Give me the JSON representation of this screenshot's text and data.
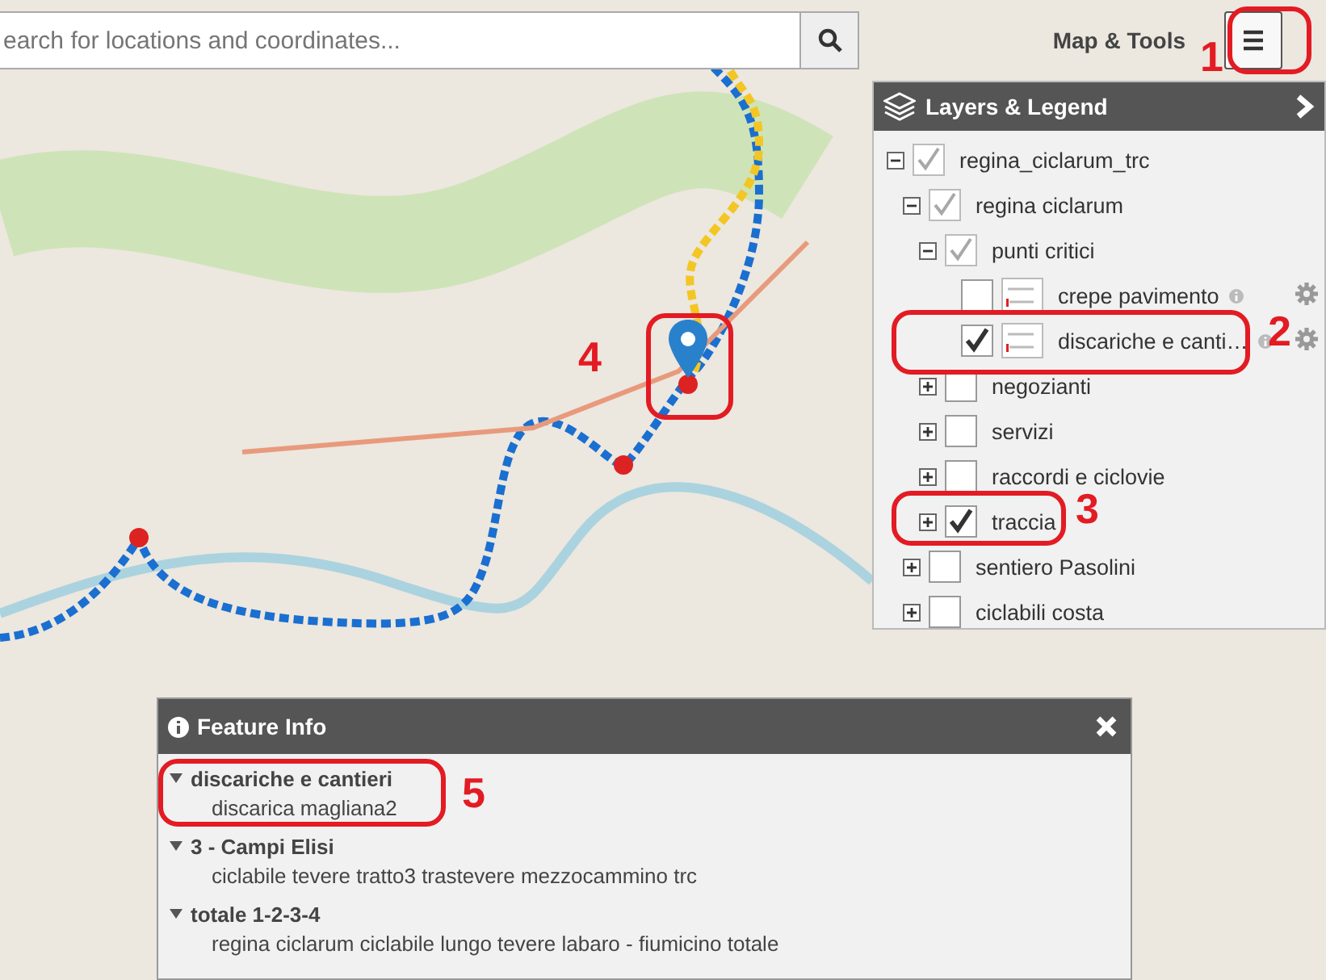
{
  "search": {
    "placeholder": "earch for locations and coordinates..."
  },
  "toolbar": {
    "label": "Map & Tools"
  },
  "layers_panel": {
    "title": "Layers & Legend",
    "tree": [
      {
        "label": "regina_ciclarum_trc",
        "checked": true,
        "mixed": true,
        "expanded": true,
        "children": [
          {
            "label": "regina ciclarum",
            "checked": true,
            "mixed": true,
            "expanded": true,
            "children": [
              {
                "label": "punti critici",
                "checked": true,
                "mixed": true,
                "expanded": true,
                "children": [
                  {
                    "label": "crepe pavimento",
                    "kind": "legend",
                    "checked": false,
                    "mixed": false
                  },
                  {
                    "label": "discariche e canti…",
                    "kind": "legend",
                    "checked": true,
                    "mixed": false
                  }
                ]
              },
              {
                "label": "negozianti",
                "checked": false,
                "mixed": false,
                "expanded": false
              },
              {
                "label": "servizi",
                "checked": false,
                "mixed": false,
                "expanded": false
              },
              {
                "label": "raccordi e ciclovie",
                "checked": false,
                "mixed": false,
                "expanded": false
              },
              {
                "label": "traccia",
                "checked": true,
                "mixed": false,
                "expanded": false
              }
            ]
          },
          {
            "label": "sentiero Pasolini",
            "checked": false,
            "mixed": false,
            "expanded": false
          },
          {
            "label": "ciclabili costa",
            "checked": false,
            "mixed": false,
            "expanded": false
          }
        ]
      }
    ]
  },
  "feature_info": {
    "title": "Feature Info",
    "groups": [
      {
        "title": "discariche e cantieri",
        "expanded": true,
        "items": [
          "discarica magliana2"
        ]
      },
      {
        "title": "3 - Campi Elisi",
        "expanded": true,
        "items": [
          "ciclabile tevere tratto3 trastevere mezzocammino trc"
        ]
      },
      {
        "title": "totale 1-2-3-4",
        "expanded": true,
        "items": [
          "regina ciclarum ciclabile lungo tevere labaro - fiumicino totale"
        ]
      }
    ]
  },
  "annotations": [
    {
      "label": "1"
    },
    {
      "label": "2"
    },
    {
      "label": "3"
    },
    {
      "label": "4"
    },
    {
      "label": "5"
    }
  ]
}
